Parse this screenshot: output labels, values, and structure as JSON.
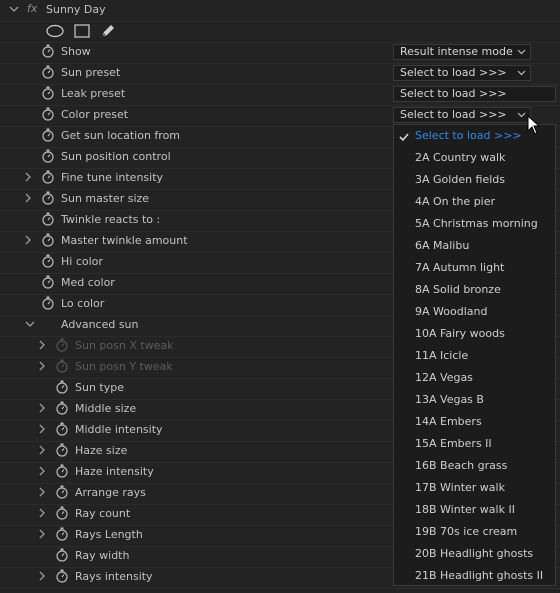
{
  "effect": {
    "name": "Sunny Day",
    "fx_label": "fx"
  },
  "rows": [
    {
      "label": "Show",
      "twirl": false,
      "stopwatch": true,
      "dropdown": "Result intense mode",
      "dd_arrow": true
    },
    {
      "label": "Sun preset",
      "twirl": false,
      "stopwatch": true,
      "dropdown": "Select to load >>>",
      "dd_arrow": true
    },
    {
      "label": "Leak preset",
      "twirl": false,
      "stopwatch": true,
      "dropdown": "Select to load >>>",
      "dd_arrow": false
    },
    {
      "label": "Color preset",
      "twirl": false,
      "stopwatch": true,
      "dropdown": "Select to load >>>",
      "dd_arrow": true
    },
    {
      "label": "Get sun location from",
      "twirl": false,
      "stopwatch": true
    },
    {
      "label": "Sun position control",
      "twirl": false,
      "stopwatch": true
    },
    {
      "label": "Fine tune intensity",
      "twirl": true,
      "stopwatch": true
    },
    {
      "label": "Sun master size",
      "twirl": true,
      "stopwatch": true
    },
    {
      "label": "Twinkle reacts to :",
      "twirl": false,
      "stopwatch": true
    },
    {
      "label": "Master twinkle amount",
      "twirl": true,
      "stopwatch": true
    },
    {
      "label": "Hi color",
      "twirl": false,
      "stopwatch": true
    },
    {
      "label": "Med color",
      "twirl": false,
      "stopwatch": true
    },
    {
      "label": "Lo color",
      "twirl": false,
      "stopwatch": true
    },
    {
      "label": "Advanced sun",
      "twirl": "open",
      "stopwatch": false
    },
    {
      "label": "Sun posn X tweak",
      "twirl": true,
      "stopwatch": true,
      "disabled": true,
      "indent": 1
    },
    {
      "label": "Sun posn Y tweak",
      "twirl": true,
      "stopwatch": true,
      "disabled": true,
      "indent": 1
    },
    {
      "label": "Sun type",
      "twirl": false,
      "stopwatch": true,
      "indent": 1
    },
    {
      "label": "Middle size",
      "twirl": true,
      "stopwatch": true,
      "indent": 1
    },
    {
      "label": "Middle intensity",
      "twirl": true,
      "stopwatch": true,
      "indent": 1
    },
    {
      "label": "Haze size",
      "twirl": true,
      "stopwatch": true,
      "indent": 1
    },
    {
      "label": "Haze intensity",
      "twirl": true,
      "stopwatch": true,
      "indent": 1
    },
    {
      "label": "Arrange rays",
      "twirl": true,
      "stopwatch": true,
      "indent": 1
    },
    {
      "label": "Ray count",
      "twirl": true,
      "stopwatch": true,
      "indent": 1
    },
    {
      "label": "Rays Length",
      "twirl": true,
      "stopwatch": true,
      "indent": 1
    },
    {
      "label": "Ray width",
      "twirl": false,
      "stopwatch": true,
      "indent": 1
    },
    {
      "label": "Rays intensity",
      "twirl": true,
      "stopwatch": true,
      "indent": 1
    }
  ],
  "menu": {
    "selected_index": 0,
    "items": [
      "Select to load >>>",
      "2A Country walk",
      "3A Golden fields",
      "4A On the pier",
      "5A Christmas morning",
      "6A Malibu",
      "7A Autumn light",
      "8A Solid bronze",
      "9A Woodland",
      "10A Fairy woods",
      "11A Icicle",
      "12A Vegas",
      "13A Vegas B",
      "14A Embers",
      "15A Embers II",
      "16B Beach grass",
      "17B Winter walk",
      "18B Winter walk II",
      "19B 70s ice cream",
      "20B Headlight ghosts",
      "21B Headlight ghosts II"
    ]
  },
  "colors": {
    "background": "#232323",
    "menu_bg": "#1c1c1c",
    "selected_text": "#2d8ceb"
  }
}
